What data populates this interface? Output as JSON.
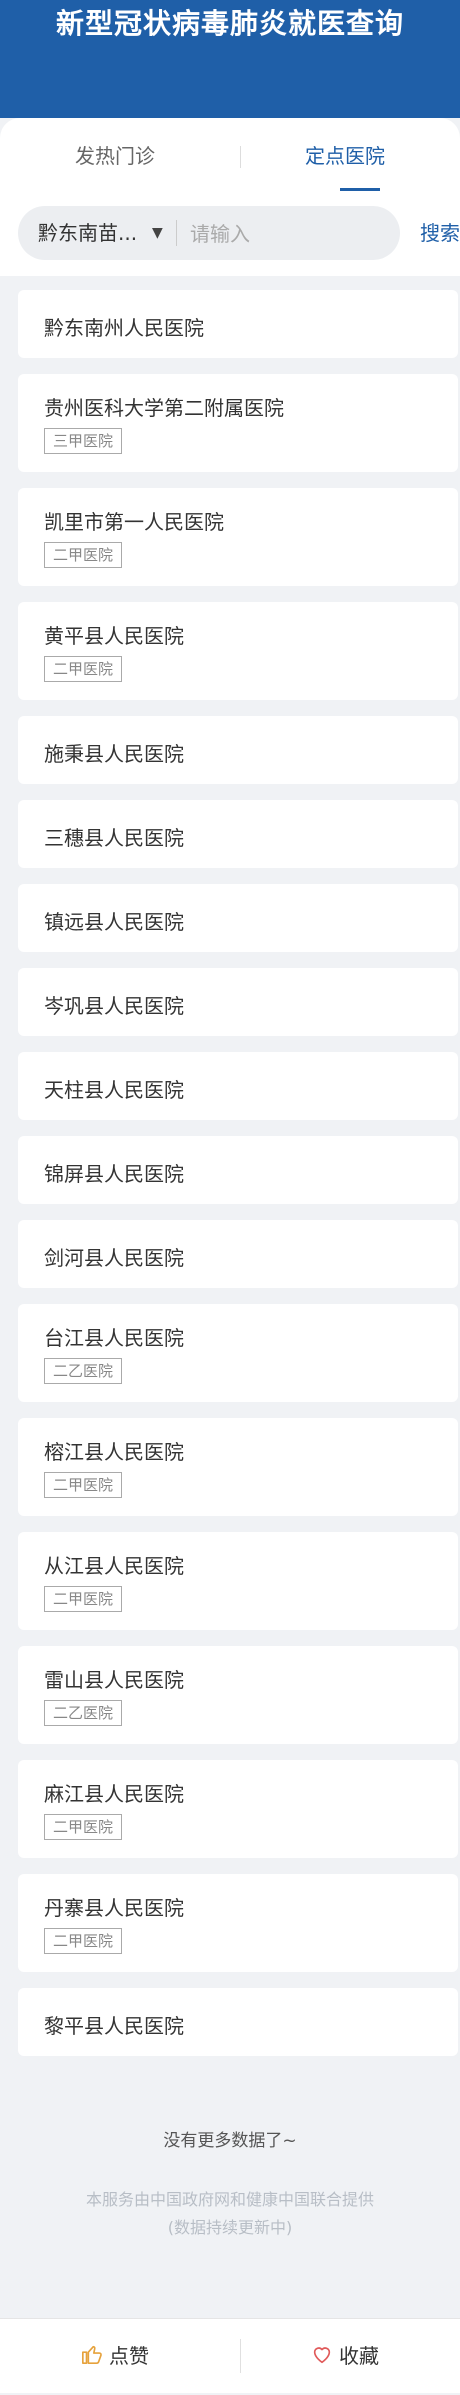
{
  "header": {
    "title": "新型冠状病毒肺炎就医查询"
  },
  "tabs": [
    {
      "label": "发热门诊",
      "active": false
    },
    {
      "label": "定点医院",
      "active": true
    }
  ],
  "search": {
    "region": "黔东南苗...",
    "placeholder": "请输入",
    "button_label": "搜索"
  },
  "hospitals": [
    {
      "name": "黔东南州人民医院",
      "level": ""
    },
    {
      "name": "贵州医科大学第二附属医院",
      "level": "三甲医院"
    },
    {
      "name": "凯里市第一人民医院",
      "level": "二甲医院"
    },
    {
      "name": "黄平县人民医院",
      "level": "二甲医院"
    },
    {
      "name": "施秉县人民医院",
      "level": ""
    },
    {
      "name": "三穗县人民医院",
      "level": ""
    },
    {
      "name": "镇远县人民医院",
      "level": ""
    },
    {
      "name": "岑巩县人民医院",
      "level": ""
    },
    {
      "name": "天柱县人民医院",
      "level": ""
    },
    {
      "name": "锦屏县人民医院",
      "level": ""
    },
    {
      "name": "剑河县人民医院",
      "level": ""
    },
    {
      "name": "台江县人民医院",
      "level": "二乙医院"
    },
    {
      "name": "榕江县人民医院",
      "level": "二甲医院"
    },
    {
      "name": "从江县人民医院",
      "level": "二甲医院"
    },
    {
      "name": "雷山县人民医院",
      "level": "二乙医院"
    },
    {
      "name": "麻江县人民医院",
      "level": "二甲医院"
    },
    {
      "name": "丹寨县人民医院",
      "level": "二甲医院"
    },
    {
      "name": "黎平县人民医院",
      "level": ""
    }
  ],
  "no_more": "没有更多数据了~",
  "footer": {
    "line1": "本服务由中国政府网和健康中国联合提供",
    "line2": "(数据持续更新中)"
  },
  "bottom_bar": {
    "like_label": "点赞",
    "like_icon": "thumbs-up-icon",
    "favorite_label": "收藏",
    "favorite_icon": "heart-icon"
  },
  "colors": {
    "brand": "#1f5fa8",
    "background": "#f0f2f5",
    "like_icon": "#e6a23c",
    "favorite_icon": "#e05a5a"
  }
}
